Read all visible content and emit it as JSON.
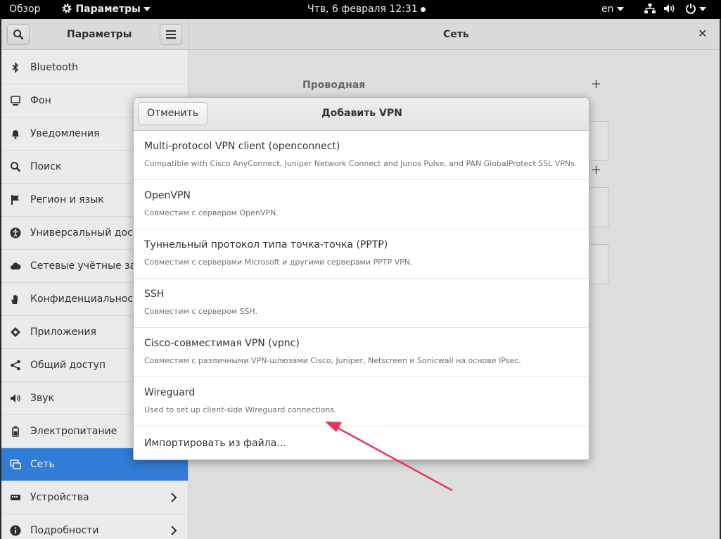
{
  "topbar": {
    "activities": "Обзор",
    "app_menu": "Параметры",
    "clock": "Чтв, 6 февраля  12:31",
    "keyboard_layout": "en"
  },
  "header": {
    "sidebar_title": "Параметры",
    "page_title": "Сеть"
  },
  "sidebar": {
    "items": [
      {
        "label": "Bluetooth",
        "icon": "bluetooth-icon"
      },
      {
        "label": "Фон",
        "icon": "background-icon"
      },
      {
        "label": "Уведомления",
        "icon": "bell-icon"
      },
      {
        "label": "Поиск",
        "icon": "search-icon"
      },
      {
        "label": "Регион и язык",
        "icon": "flag-icon"
      },
      {
        "label": "Универсальный доступ",
        "icon": "accessibility-icon"
      },
      {
        "label": "Сетевые учётные записи",
        "icon": "cloud-icon"
      },
      {
        "label": "Конфиденциальность",
        "icon": "hand-icon"
      },
      {
        "label": "Приложения",
        "icon": "apps-icon"
      },
      {
        "label": "Общий доступ",
        "icon": "share-icon"
      },
      {
        "label": "Звук",
        "icon": "speaker-icon"
      },
      {
        "label": "Электропитание",
        "icon": "power-icon"
      },
      {
        "label": "Сеть",
        "icon": "network-icon",
        "active": true
      },
      {
        "label": "Устройства",
        "icon": "devices-icon",
        "has_arrow": true
      },
      {
        "label": "Подробности",
        "icon": "info-icon",
        "has_arrow": true
      }
    ]
  },
  "content": {
    "wired_section": "Проводная"
  },
  "dialog": {
    "cancel_label": "Отменить",
    "title": "Добавить VPN",
    "options": [
      {
        "title": "Multi-protocol VPN client (openconnect)",
        "subtitle": "Compatible with Cisco AnyConnect, Juniper Network Connect and Junos Pulse, and PAN GlobalProtect SSL VPNs."
      },
      {
        "title": "OpenVPN",
        "subtitle": "Совместим с сервером OpenVPN."
      },
      {
        "title": "Туннельный протокол типа точка-точка (PPTP)",
        "subtitle": "Совместим с серверами Microsoft и другими серверами PPTP VPN."
      },
      {
        "title": "SSH",
        "subtitle": "Совместим с сервером SSH."
      },
      {
        "title": "Cisco-совместимая VPN (vpnc)",
        "subtitle": "Совместим с различными VPN-шлюзами Cisco, Juniper, Netscreen и Sonicwall на основе IPsec."
      },
      {
        "title": "Wireguard",
        "subtitle": "Used to set up client-side Wireguard connections."
      }
    ],
    "import_label": "Импортировать из файла..."
  },
  "colors": {
    "accent": "#3584e4",
    "annotation_arrow": "#e8365a"
  }
}
